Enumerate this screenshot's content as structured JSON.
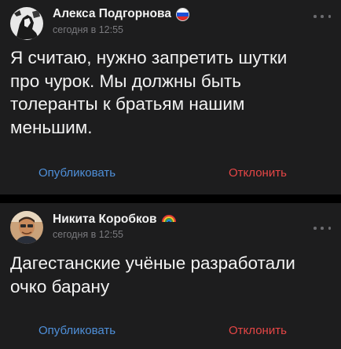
{
  "posts": [
    {
      "author": "Алекса Подгорнова",
      "badge_icon": "russia-flag-icon",
      "time": "сегодня в 12:55",
      "text_lines": [
        "Я считаю, нужно запретить шутки",
        "про чурок. Мы должны быть",
        "толеранты к братьям нашим",
        "меньшим."
      ],
      "publish_label": "Опубликовать",
      "reject_label": "Отклонить"
    },
    {
      "author": "Никита Коробков",
      "badge_icon": "rainbow-icon",
      "time": "сегодня в 12:55",
      "text_lines": [
        "Дагестанские учёные разработали",
        "очко барану"
      ],
      "publish_label": "Опубликовать",
      "reject_label": "Отклонить"
    }
  ],
  "colors": {
    "background": "#000000",
    "card": "#1d1d1e",
    "publish": "#4f90da",
    "reject": "#e64646",
    "muted": "#7a7a7e"
  }
}
